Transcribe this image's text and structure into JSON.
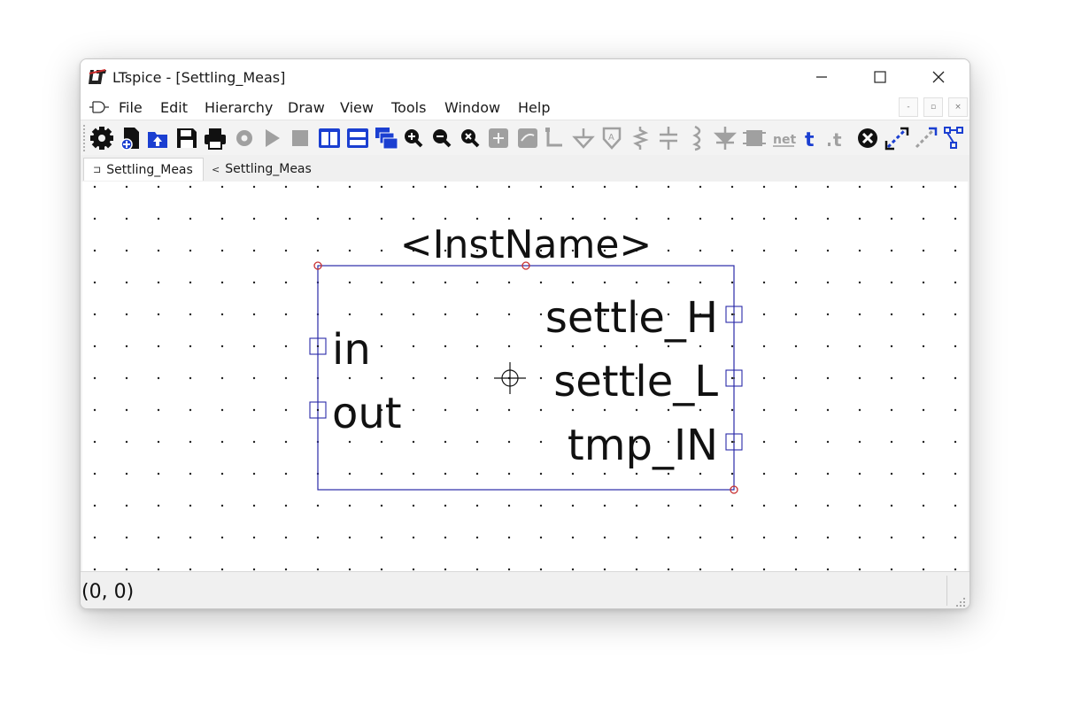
{
  "window": {
    "title": "LTspice - [Settling_Meas]",
    "controls": {
      "minimize": "minimize-icon",
      "maximize": "maximize-icon",
      "close": "close-icon"
    }
  },
  "menubar": {
    "items": [
      "File",
      "Edit",
      "Hierarchy",
      "Draw",
      "View",
      "Tools",
      "Window",
      "Help"
    ],
    "mdi": {
      "minimize": "-",
      "restore": "▫",
      "close": "×"
    }
  },
  "toolbar": {
    "icons": [
      "gear-icon",
      "new-schematic-icon",
      "open-icon",
      "save-icon",
      "print-icon",
      "run-disabled-icon",
      "play-disabled-icon",
      "stop-disabled-icon",
      "tile-vertical-icon",
      "tile-horizontal-icon",
      "cascade-icon",
      "zoom-in-icon",
      "zoom-out-icon",
      "zoom-fit-icon",
      "zoom-area-disabled-icon",
      "pan-disabled-icon",
      "wire-disabled-icon",
      "ground-disabled-icon",
      "label-disabled-icon",
      "resistor-disabled-icon",
      "capacitor-disabled-icon",
      "inductor-disabled-icon",
      "diode-disabled-icon",
      "component-disabled-icon",
      "net-icon",
      "text-icon",
      "spice-directive-icon",
      "delete-icon",
      "move-icon",
      "drag-icon",
      "rotate-icon"
    ],
    "net_label": "net",
    "text_label": "t"
  },
  "tabs": [
    {
      "label": "Settling_Meas",
      "icon": "symbol-icon",
      "active": true
    },
    {
      "label": "Settling_Meas",
      "icon": "schematic-icon",
      "active": false
    }
  ],
  "symbol": {
    "inst_name": "<InstName>",
    "pins_left": [
      "in",
      "out"
    ],
    "pins_right": [
      "settle_H",
      "settle_L",
      "tmp_IN"
    ]
  },
  "status": {
    "coords": "(0, 0)"
  },
  "colors": {
    "box": "#2a2aa8",
    "handle": "#c83030",
    "toolbar_blue": "#1b3fd1",
    "disabled": "#a0a0a0"
  }
}
